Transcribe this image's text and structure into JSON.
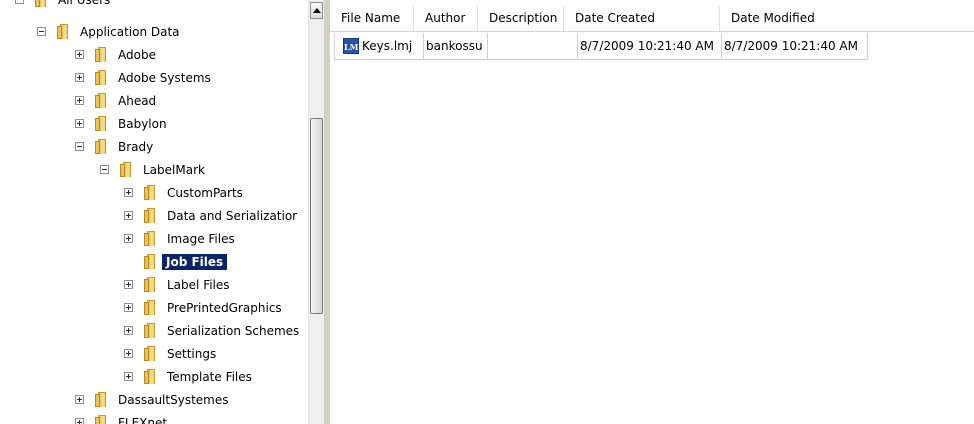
{
  "tree": {
    "items": [
      {
        "label": "All Users",
        "expander": "minus",
        "selected": false
      },
      {
        "label": "Application Data",
        "expander": "minus",
        "selected": false
      },
      {
        "label": "Adobe",
        "expander": "plus",
        "selected": false
      },
      {
        "label": "Adobe Systems",
        "expander": "plus",
        "selected": false
      },
      {
        "label": "Ahead",
        "expander": "plus",
        "selected": false
      },
      {
        "label": "Babylon",
        "expander": "plus",
        "selected": false
      },
      {
        "label": "Brady",
        "expander": "minus",
        "selected": false
      },
      {
        "label": "LabelMark",
        "expander": "minus",
        "selected": false
      },
      {
        "label": "CustomParts",
        "expander": "plus",
        "selected": false
      },
      {
        "label": "Data and Serializatior",
        "expander": "plus",
        "selected": false
      },
      {
        "label": "Image Files",
        "expander": "plus",
        "selected": false
      },
      {
        "label": "Job Files",
        "expander": "none",
        "selected": true
      },
      {
        "label": "Label Files",
        "expander": "plus",
        "selected": false
      },
      {
        "label": "PrePrintedGraphics",
        "expander": "plus",
        "selected": false
      },
      {
        "label": "Serialization Schemes",
        "expander": "plus",
        "selected": false
      },
      {
        "label": "Settings",
        "expander": "plus",
        "selected": false
      },
      {
        "label": "Template Files",
        "expander": "plus",
        "selected": false
      },
      {
        "label": "DassaultSystemes",
        "expander": "plus",
        "selected": false
      },
      {
        "label": "FLEXnet",
        "expander": "plus",
        "selected": false
      }
    ]
  },
  "list": {
    "columns": [
      "File Name",
      "Author",
      "Description",
      "Date Created",
      "Date Modified"
    ],
    "rows": [
      {
        "icon": "LM",
        "file_name": "Keys.lmj",
        "author": "bankossu",
        "description": "",
        "date_created": "8/7/2009 10:21:40 AM",
        "date_modified": "8/7/2009 10:21:40 AM"
      }
    ]
  },
  "colors": {
    "selection": "#0a246a",
    "folder": "#f1cf6b",
    "file_icon": "#2553a7"
  }
}
